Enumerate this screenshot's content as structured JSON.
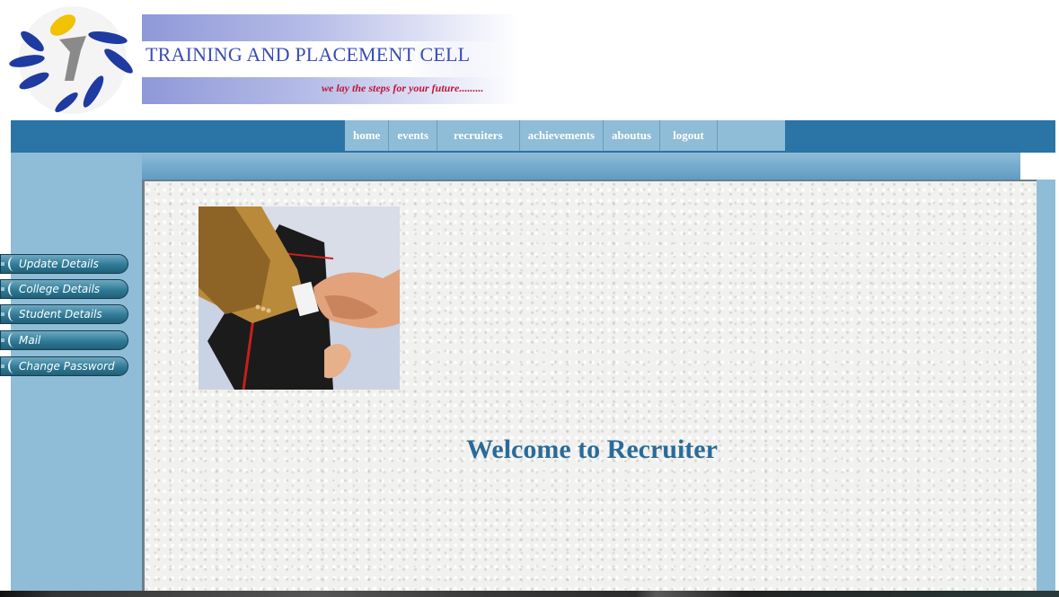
{
  "header": {
    "title": "TRAINING AND PLACEMENT CELL",
    "tagline": "we lay the steps for your future........."
  },
  "nav": {
    "items": [
      {
        "label": "home"
      },
      {
        "label": "events"
      },
      {
        "label": "recruiters"
      },
      {
        "label": "achievements"
      },
      {
        "label": "aboutus"
      },
      {
        "label": "logout"
      }
    ]
  },
  "sidebar": {
    "items": [
      {
        "label": "Update Details"
      },
      {
        "label": "College Details"
      },
      {
        "label": "Student Details"
      },
      {
        "label": "Mail"
      },
      {
        "label": "Change Password"
      }
    ]
  },
  "main": {
    "welcome": "Welcome to Recruiter"
  },
  "colors": {
    "nav_bar": "#2a74a6",
    "side_panel": "#8fbcd6",
    "welcome_text": "#2a6b98",
    "banner_title": "#3a4cb6",
    "tagline": "#c0143c"
  }
}
